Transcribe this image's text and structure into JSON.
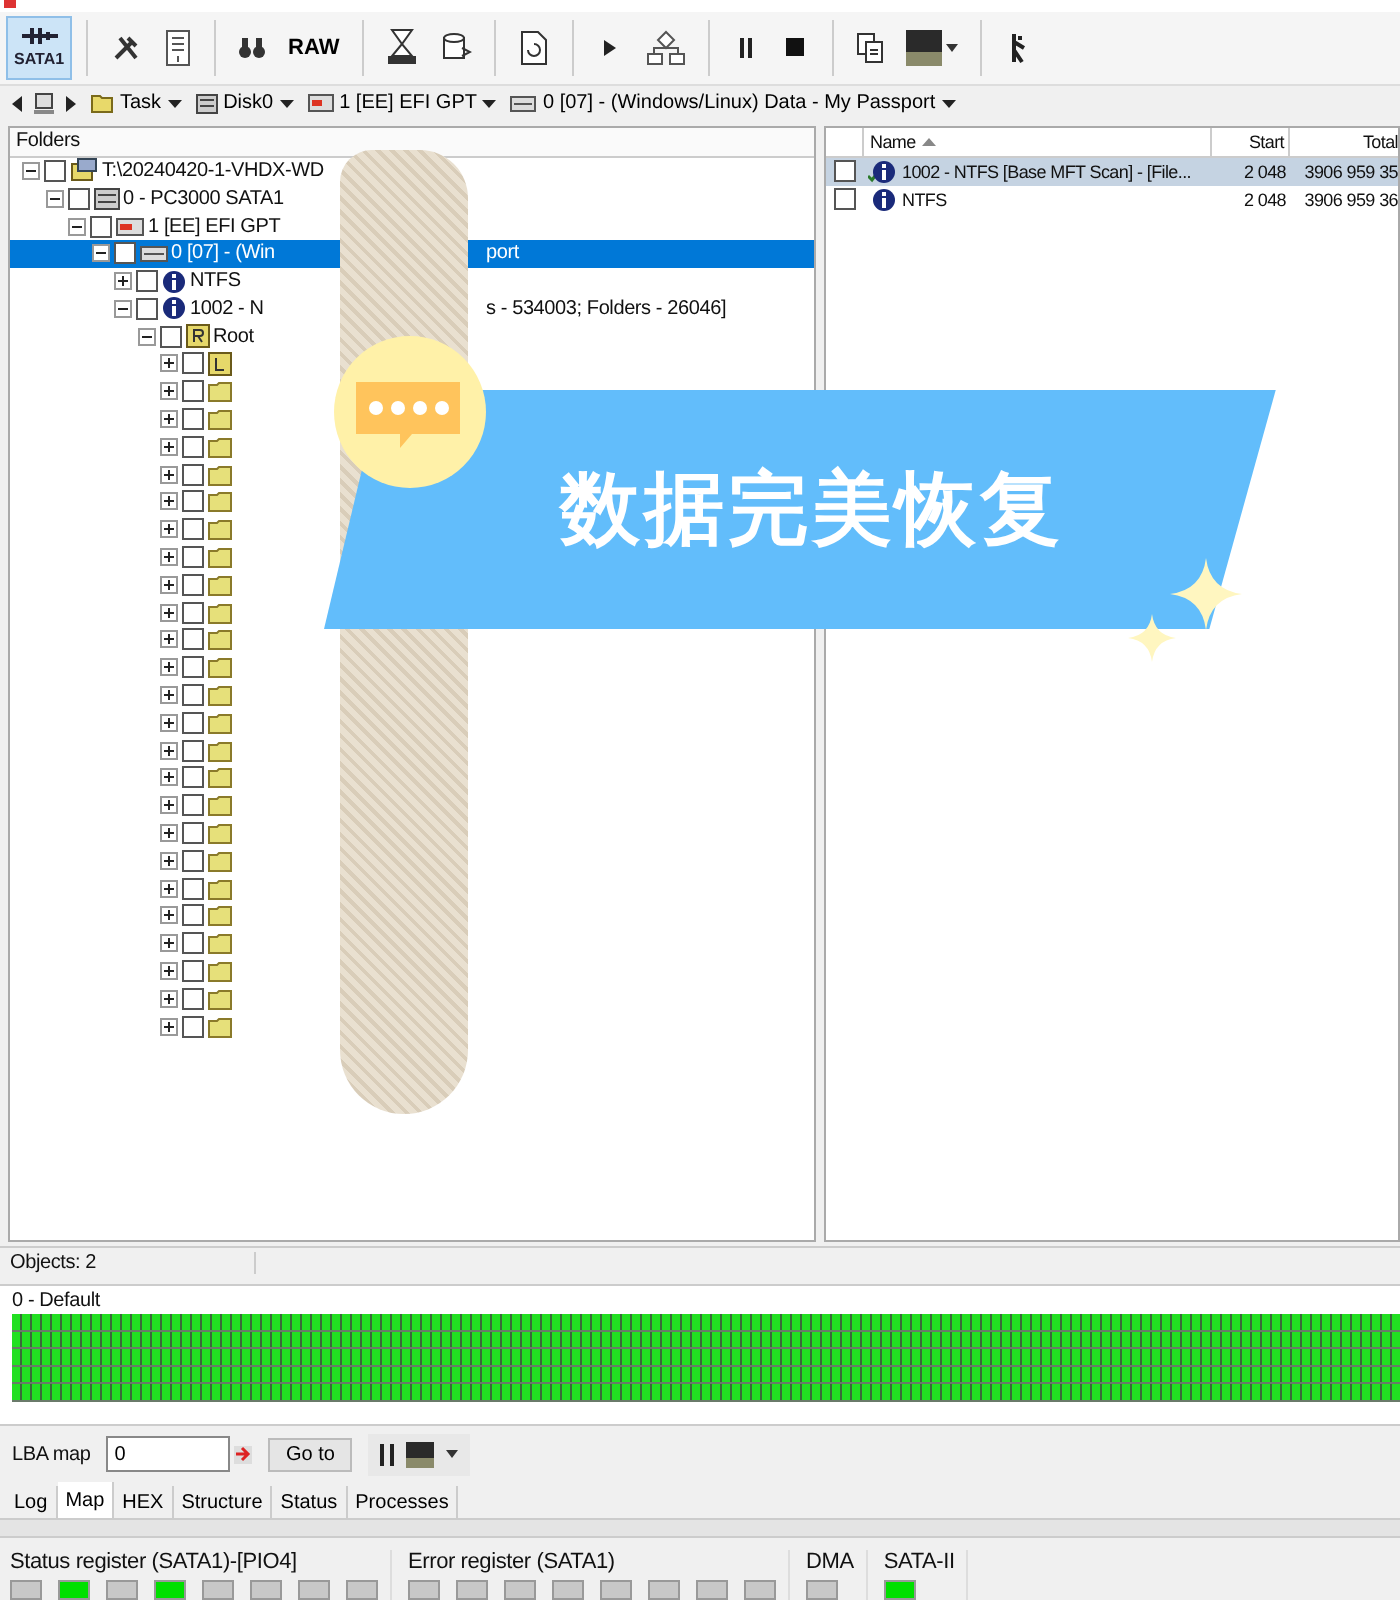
{
  "toolbar": [
    {
      "kind": "sata",
      "label": "SATA1",
      "selected": true
    },
    {
      "kind": "separator"
    },
    {
      "kind": "tools",
      "selected": false
    },
    {
      "kind": "scroll",
      "selected": false
    },
    {
      "kind": "separator"
    },
    {
      "kind": "binoculars",
      "selected": false
    },
    {
      "kind": "text",
      "label": "RAW",
      "selected": false
    },
    {
      "kind": "separator"
    },
    {
      "kind": "hourglass",
      "selected": false
    },
    {
      "kind": "database",
      "selected": false
    },
    {
      "kind": "separator"
    },
    {
      "kind": "document",
      "selected": false
    },
    {
      "kind": "separator"
    },
    {
      "kind": "play",
      "selected": false
    },
    {
      "kind": "flowchart",
      "selected": false
    },
    {
      "kind": "separator"
    },
    {
      "kind": "pause",
      "selected": false
    },
    {
      "kind": "stop",
      "selected": false
    },
    {
      "kind": "separator"
    },
    {
      "kind": "copy",
      "selected": false
    },
    {
      "kind": "thumbnail",
      "selected": false
    },
    {
      "kind": "separator"
    },
    {
      "kind": "walker",
      "selected": false
    }
  ],
  "breadcrumb": [
    {
      "kind": "task",
      "label": "Task"
    },
    {
      "kind": "disk",
      "label": "Disk0"
    },
    {
      "kind": "partition",
      "label": "1 [EE] EFI GPT"
    },
    {
      "kind": "volume",
      "label": "0 [07] - (Windows/Linux) Data - My Passport"
    }
  ],
  "tree": {
    "header": "Folders",
    "items": [
      {
        "kind": "image",
        "text": "T:\\20240420-1-VHDX-WD",
        "expanded": true,
        "checked": false,
        "selected": false,
        "children": [
          {
            "kind": "disk",
            "text": "0 - PC3000 SATA1",
            "expanded": true,
            "checked": false,
            "selected": false,
            "children": [
              {
                "kind": "partition",
                "text": "1 [EE] EFI GPT",
                "expanded": true,
                "checked": false,
                "selected": false,
                "children": [
                  {
                    "kind": "volume",
                    "text": "0 [07] - (Win",
                    "text_after": "port",
                    "expanded": true,
                    "checked": false,
                    "selected": true,
                    "children": [
                      {
                        "kind": "info",
                        "text": "NTFS",
                        "expanded": false,
                        "checked": false,
                        "selected": false
                      },
                      {
                        "kind": "info",
                        "text": "1002 - N",
                        "text_after": "s - 534003; Folders - 26046]",
                        "expanded": true,
                        "checked": false,
                        "selected": false,
                        "children": [
                          {
                            "kind": "root",
                            "text": "Root",
                            "expanded": true,
                            "checked": false,
                            "selected": false,
                            "children": [
                              {
                                "kind": "lost-folder",
                                "expanded": false,
                                "checked": false,
                                "selected": false
                              },
                              {
                                "kind": "folder",
                                "expanded": false,
                                "checked": false,
                                "selected": false
                              },
                              {
                                "kind": "folder",
                                "expanded": false,
                                "checked": false,
                                "selected": false
                              },
                              {
                                "kind": "folder",
                                "expanded": false,
                                "checked": false,
                                "selected": false
                              },
                              {
                                "kind": "folder",
                                "expanded": false,
                                "checked": false,
                                "selected": false
                              },
                              {
                                "kind": "folder",
                                "expanded": false,
                                "checked": false,
                                "selected": false
                              },
                              {
                                "kind": "folder",
                                "expanded": false,
                                "checked": false,
                                "selected": false
                              },
                              {
                                "kind": "folder",
                                "expanded": false,
                                "checked": false,
                                "selected": false
                              },
                              {
                                "kind": "folder",
                                "expanded": false,
                                "checked": false,
                                "selected": false
                              },
                              {
                                "kind": "folder",
                                "expanded": false,
                                "checked": false,
                                "selected": false
                              },
                              {
                                "kind": "folder",
                                "expanded": false,
                                "checked": false,
                                "selected": false
                              },
                              {
                                "kind": "folder",
                                "expanded": false,
                                "checked": false,
                                "selected": false
                              },
                              {
                                "kind": "folder",
                                "expanded": false,
                                "checked": false,
                                "selected": false
                              },
                              {
                                "kind": "folder",
                                "expanded": false,
                                "checked": false,
                                "selected": false
                              },
                              {
                                "kind": "folder",
                                "expanded": false,
                                "checked": false,
                                "selected": false
                              },
                              {
                                "kind": "folder",
                                "expanded": false,
                                "checked": false,
                                "selected": false
                              },
                              {
                                "kind": "folder",
                                "expanded": false,
                                "checked": false,
                                "selected": false
                              },
                              {
                                "kind": "folder",
                                "expanded": false,
                                "checked": false,
                                "selected": false
                              },
                              {
                                "kind": "folder",
                                "expanded": false,
                                "checked": false,
                                "selected": false
                              },
                              {
                                "kind": "folder",
                                "expanded": false,
                                "checked": false,
                                "selected": false
                              },
                              {
                                "kind": "folder",
                                "expanded": false,
                                "checked": false,
                                "selected": false
                              },
                              {
                                "kind": "folder",
                                "expanded": false,
                                "checked": false,
                                "selected": false
                              },
                              {
                                "kind": "folder",
                                "expanded": false,
                                "checked": false,
                                "selected": false
                              },
                              {
                                "kind": "folder",
                                "expanded": false,
                                "checked": false,
                                "selected": false
                              },
                              {
                                "kind": "folder",
                                "expanded": false,
                                "checked": false,
                                "selected": false
                              }
                            ]
                          }
                        ]
                      }
                    ]
                  }
                ]
              }
            ]
          }
        ]
      }
    ]
  },
  "table": {
    "columns": [
      "Name",
      "Start",
      "Total"
    ],
    "rows": [
      {
        "name": "1002 - NTFS [Base MFT Scan] - [File...",
        "start": "2 048",
        "total": "3906 959 35",
        "checked": false,
        "selected": true,
        "scanned": true
      },
      {
        "name": "NTFS",
        "start": "2 048",
        "total": "3906 959 36",
        "checked": false,
        "selected": false,
        "scanned": false
      }
    ]
  },
  "status_bar": {
    "objects": "Objects: 2"
  },
  "map": {
    "title": "0 - Default"
  },
  "lba": {
    "label": "LBA map",
    "value": "0",
    "button": "Go to"
  },
  "tabs": [
    {
      "label": "Log",
      "selected": false
    },
    {
      "label": "Map",
      "selected": true
    },
    {
      "label": "HEX",
      "selected": false
    },
    {
      "label": "Structure",
      "selected": false
    },
    {
      "label": "Status",
      "selected": false
    },
    {
      "label": "Processes",
      "selected": false
    }
  ],
  "registers": [
    {
      "title": "Status register (SATA1)-[PIO4]",
      "leds": [
        {
          "on": false
        },
        {
          "on": true
        },
        {
          "on": false
        },
        {
          "on": true
        },
        {
          "on": false
        },
        {
          "on": false
        },
        {
          "on": false
        },
        {
          "on": false
        }
      ]
    },
    {
      "title": "Error register (SATA1)",
      "leds": [
        {
          "on": false
        },
        {
          "on": false
        },
        {
          "on": false
        },
        {
          "on": false
        },
        {
          "on": false
        },
        {
          "on": false
        },
        {
          "on": false
        },
        {
          "on": false
        }
      ]
    },
    {
      "title": "DMA",
      "leds": [
        {
          "on": false
        }
      ]
    },
    {
      "title": "SATA-II",
      "leds": [
        {
          "on": true
        }
      ]
    }
  ],
  "banner": {
    "text": "数据完美恢复"
  }
}
